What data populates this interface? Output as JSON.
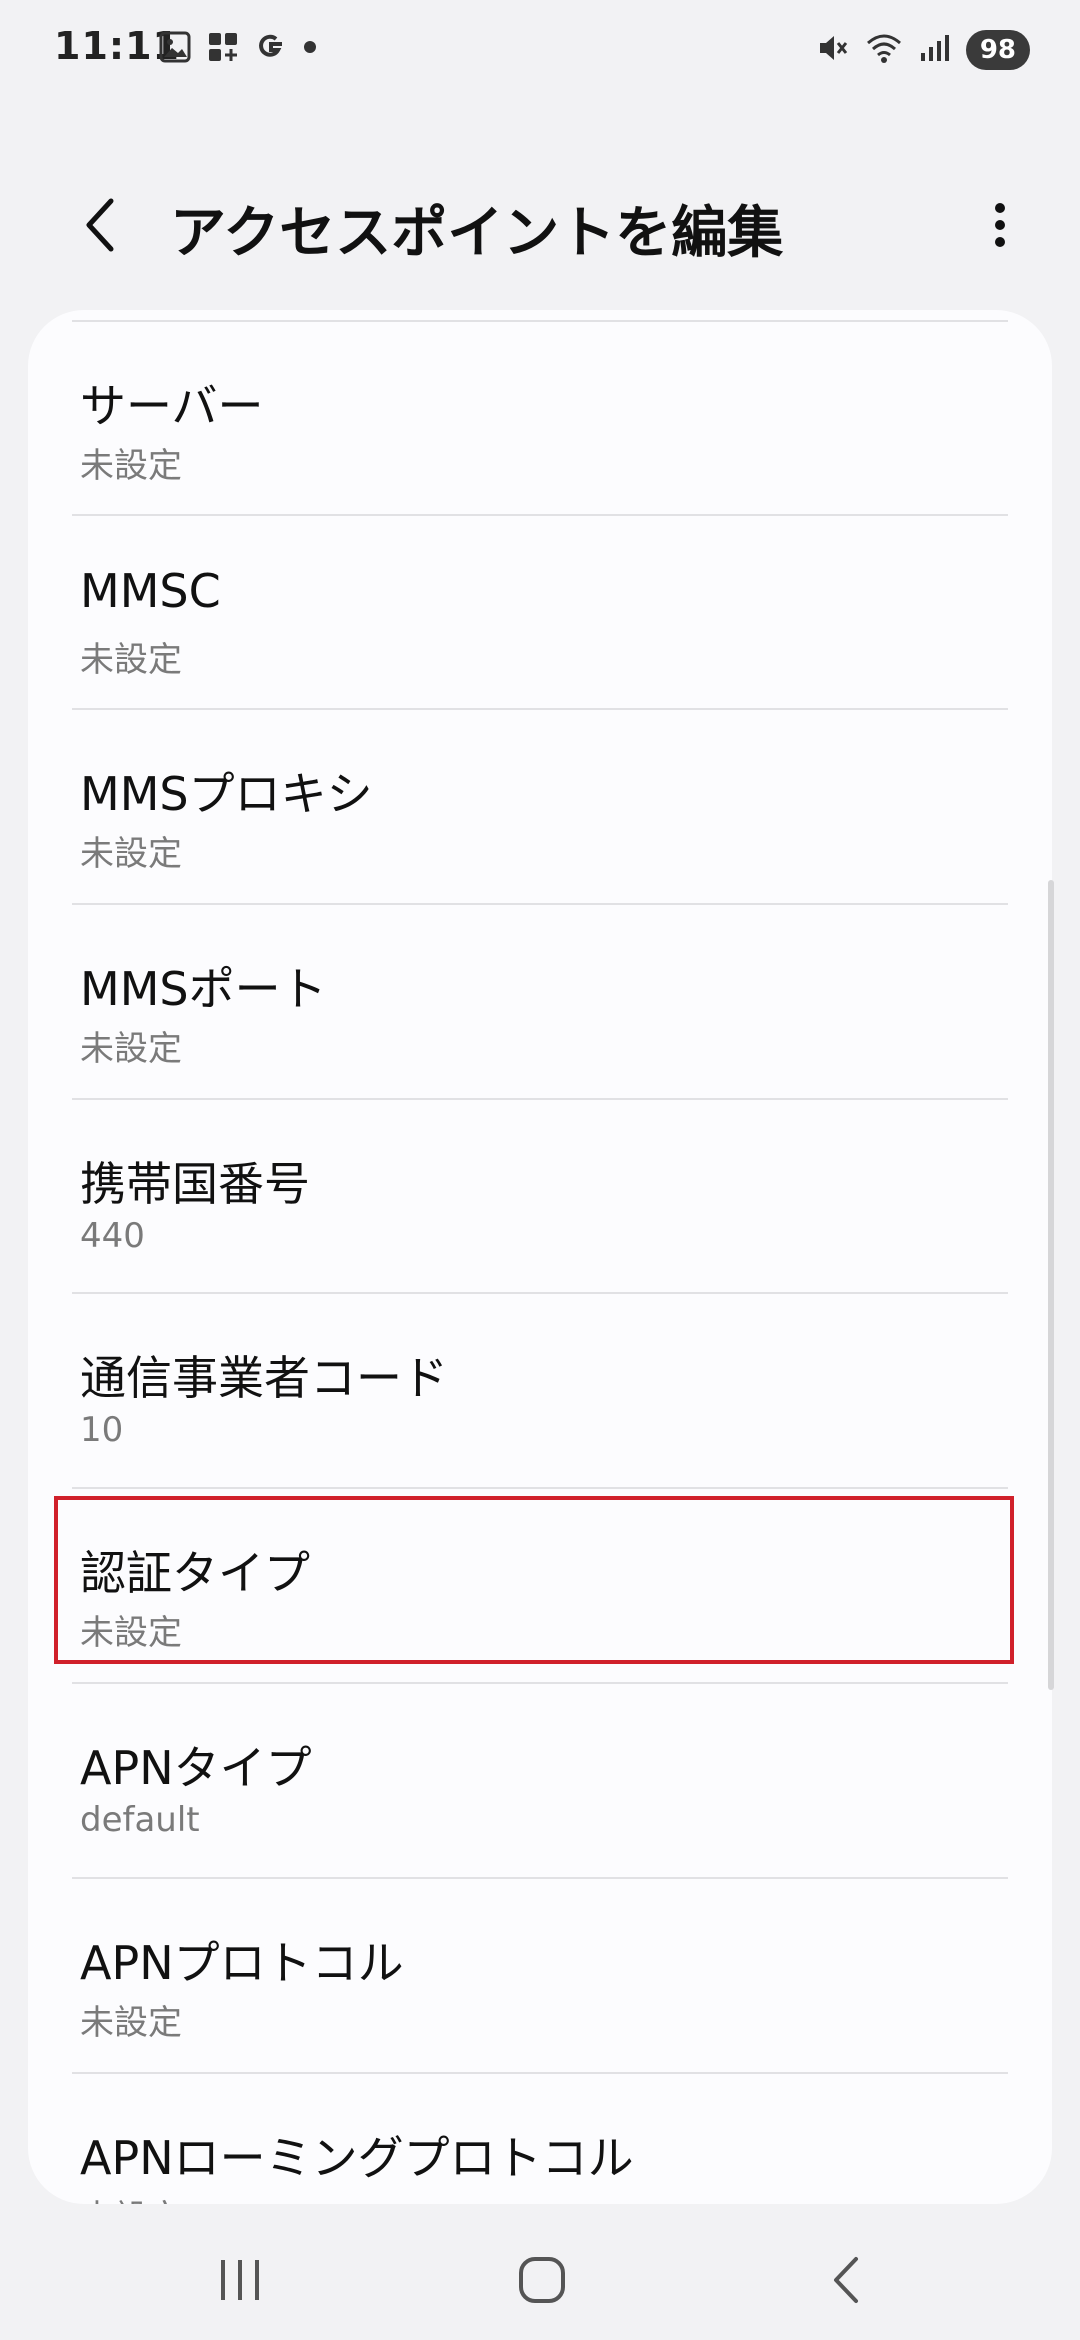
{
  "status_bar": {
    "time": "11:11",
    "battery": "98",
    "left_icons": [
      "gallery-icon",
      "widgets-icon",
      "google-icon",
      "dot-icon"
    ],
    "right_icons": [
      "mute-icon",
      "wifi-icon",
      "signal-icon"
    ]
  },
  "app_bar": {
    "title": "アクセスポイントを編集",
    "back_icon": "chevron-left-icon",
    "more_icon": "more-vertical-icon"
  },
  "settings": {
    "items": [
      {
        "label": "サーバー",
        "value": "未設定"
      },
      {
        "label": "MMSC",
        "value": "未設定"
      },
      {
        "label": "MMSプロキシ",
        "value": "未設定"
      },
      {
        "label": "MMSポート",
        "value": "未設定"
      },
      {
        "label": "携帯国番号",
        "value": "440"
      },
      {
        "label": "通信事業者コード",
        "value": "10"
      },
      {
        "label": "認証タイプ",
        "value": "未設定"
      },
      {
        "label": "APNタイプ",
        "value": "default"
      },
      {
        "label": "APNプロトコル",
        "value": "未設定"
      },
      {
        "label": "APNローミングプロトコル",
        "value": "未設定"
      }
    ]
  },
  "highlight_color": "#d0202a",
  "nav_bar": {
    "icons": [
      "recents-icon",
      "home-icon",
      "back-icon"
    ]
  }
}
